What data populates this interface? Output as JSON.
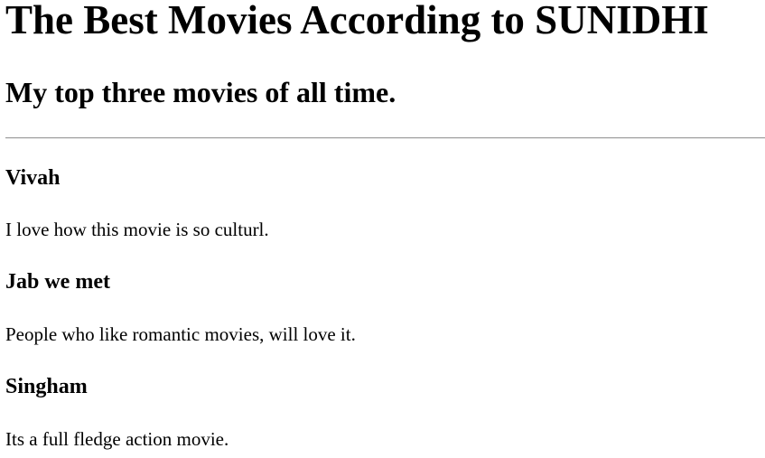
{
  "page": {
    "title": "The Best Movies According to SUNIDHI",
    "subtitle": "My top three movies of all time."
  },
  "movies": [
    {
      "title": "Vivah",
      "description": "I love how this movie is so culturl."
    },
    {
      "title": "Jab we met",
      "description": "People who like romantic movies, will love it."
    },
    {
      "title": "Singham",
      "description": "Its a full fledge action movie."
    }
  ]
}
